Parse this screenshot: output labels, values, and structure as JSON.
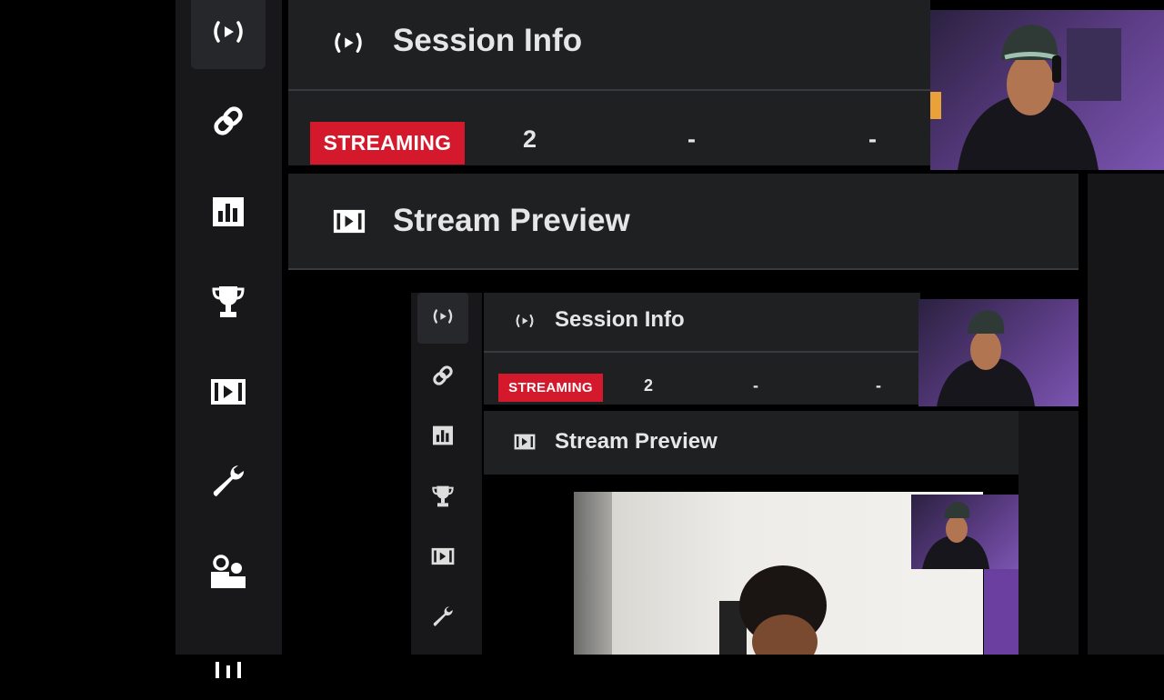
{
  "session": {
    "title": "Session Info",
    "status_badge": "STREAMING",
    "stat_1": "2",
    "stat_2": "-",
    "stat_3": "-"
  },
  "preview": {
    "title": "Stream Preview"
  },
  "nested": {
    "session_title": "Session Info",
    "status_badge": "STREAMING",
    "stat_1": "2",
    "stat_2": "-",
    "stat_3": "-",
    "preview_title": "Stream Preview"
  },
  "sidebar": {
    "items": [
      {
        "icon": "broadcast-icon",
        "active": true
      },
      {
        "icon": "link-icon"
      },
      {
        "icon": "chart-icon"
      },
      {
        "icon": "trophy-icon"
      },
      {
        "icon": "video-preview-icon"
      },
      {
        "icon": "wrench-icon"
      },
      {
        "icon": "users-icon"
      },
      {
        "icon": "equalizer-icon"
      }
    ]
  },
  "colors": {
    "badge": "#d4192c",
    "panel": "#1f2022",
    "sidebar": "#18181a",
    "background": "#000000"
  }
}
